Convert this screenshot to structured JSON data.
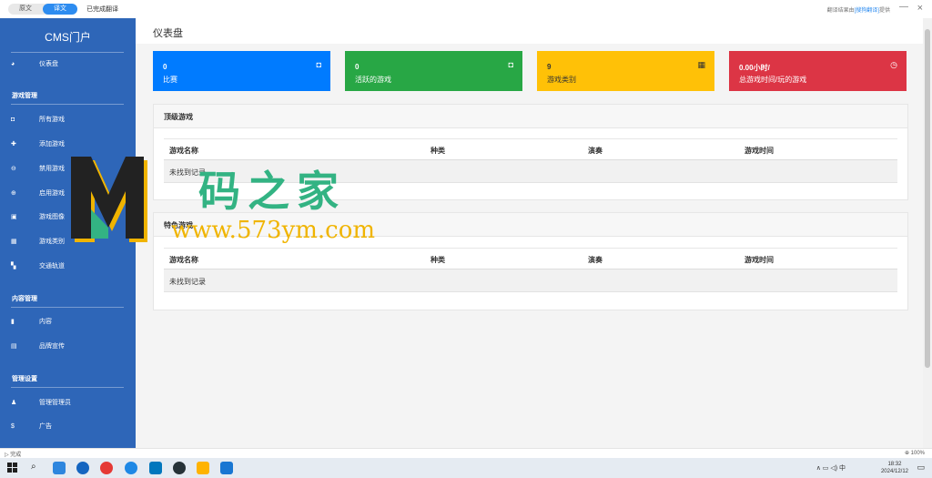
{
  "translate_bar": {
    "tab_original": "原文",
    "tab_translated": "译文",
    "status": "已完成翻译",
    "credit_prefix": "翻译结果由",
    "credit_link": "[搜狗翻译]",
    "credit_suffix": "提供",
    "more": "—",
    "close": "×"
  },
  "sidebar": {
    "brand": "CMS门户",
    "dashboard": "仪表盘",
    "sections": [
      {
        "title": "游戏管理"
      },
      {
        "title": "内容管理"
      },
      {
        "title": "管理设置"
      }
    ],
    "items": [
      {
        "label": "所有游戏",
        "icon": "gamepad-icon"
      },
      {
        "label": "添加游戏",
        "icon": "plus-icon"
      },
      {
        "label": "禁用游戏",
        "icon": "minus-circle-icon"
      },
      {
        "label": "启用游戏",
        "icon": "plus-circle-icon"
      },
      {
        "label": "游戏图像",
        "icon": "image-icon"
      },
      {
        "label": "游戏类别",
        "icon": "grid-icon"
      },
      {
        "label": "交通轨道",
        "icon": "map-icon"
      },
      {
        "label": "内容",
        "icon": "bookmark-icon"
      },
      {
        "label": "品牌宣传",
        "icon": "card-icon"
      },
      {
        "label": "管理管理员",
        "icon": "users-icon"
      },
      {
        "label": "广告",
        "icon": "dollar-icon"
      }
    ]
  },
  "page": {
    "title": "仪表盘"
  },
  "cards": [
    {
      "value": "0",
      "label": "比赛",
      "color": "#007bff",
      "icon": "gamepad-icon"
    },
    {
      "value": "0",
      "label": "活跃的游戏",
      "color": "#28a745",
      "icon": "gamepad-icon"
    },
    {
      "value": "9",
      "label": "游戏类别",
      "color": "#ffc107",
      "icon": "grid-icon"
    },
    {
      "value": "0.00小时/",
      "label": "总游戏时间/玩的游戏",
      "color": "#dc3545",
      "icon": "clock-icon"
    }
  ],
  "top_games": {
    "title": "顶级游戏",
    "columns": [
      "游戏名称",
      "种类",
      "演奏",
      "游戏时间"
    ],
    "empty": "未找到记录"
  },
  "featured_games": {
    "title": "特色游戏",
    "columns": [
      "游戏名称",
      "种类",
      "演奏",
      "游戏时间"
    ],
    "empty": "未找到记录"
  },
  "status_bar": {
    "left": "完成",
    "zoom": "100%"
  },
  "taskbar": {
    "time": "18:32",
    "date": "2024/12/12",
    "ime": "中"
  },
  "watermark": {
    "text": "码之家",
    "url": "www.573ym.com"
  }
}
